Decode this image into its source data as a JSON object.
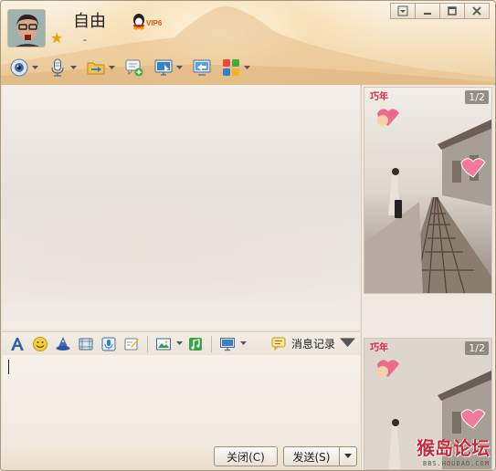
{
  "contact": {
    "name": "自由",
    "signature": "-",
    "vip_badge": "VIP6"
  },
  "window_controls": [
    {
      "icon": "dropdown-icon"
    },
    {
      "icon": "minimize-icon"
    },
    {
      "icon": "maximize-icon"
    },
    {
      "icon": "close-icon"
    }
  ],
  "main_toolbar": [
    {
      "icon": "video-camera-icon",
      "has_menu": true
    },
    {
      "icon": "microphone-icon",
      "has_menu": true
    },
    {
      "icon": "file-transfer-icon",
      "has_menu": true
    },
    {
      "icon": "create-group-icon",
      "has_menu": false
    },
    {
      "icon": "remote-desktop-icon",
      "has_menu": true
    },
    {
      "icon": "screen-share-icon",
      "has_menu": false
    },
    {
      "icon": "apps-icon",
      "has_menu": true
    }
  ],
  "input_toolbar": [
    {
      "icon": "font-icon"
    },
    {
      "icon": "emoji-icon"
    },
    {
      "icon": "shake-icon"
    },
    {
      "icon": "magic-expression-icon"
    },
    {
      "icon": "voice-message-icon"
    },
    {
      "icon": "graffiti-icon"
    },
    {
      "icon": "image-icon"
    },
    {
      "icon": "music-icon"
    },
    {
      "icon": "screenshot-icon"
    }
  ],
  "history": {
    "label": "消息记录",
    "icon": "message-history-icon"
  },
  "buttons": {
    "close": "关闭(C)",
    "send": "发送(S)"
  },
  "show_panel": {
    "top_pager": "1/2",
    "bottom_pager": "1/2",
    "card_label": "巧年"
  },
  "watermark": {
    "title": "猴岛论坛",
    "url": "BBS.HOUDAO.COM"
  }
}
